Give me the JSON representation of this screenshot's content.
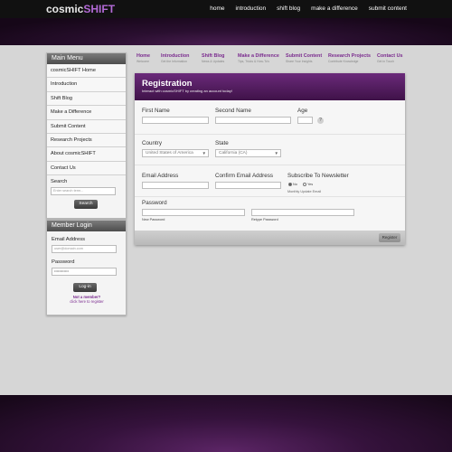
{
  "site": {
    "logo_part1": "cosmic",
    "logo_part2": "SHIFT",
    "accent": "#b36ad6",
    "brand_purple": "#6a2a7a"
  },
  "top_nav": [
    "home",
    "introduction",
    "shift blog",
    "make a difference",
    "submit content"
  ],
  "sub_nav": [
    {
      "title": "Home",
      "sub": "Welcome"
    },
    {
      "title": "Introduction",
      "sub": "Get the Information"
    },
    {
      "title": "Shift Blog",
      "sub": "News & Updates"
    },
    {
      "title": "Make a Difference",
      "sub": "Tips, Tricks & How-To's"
    },
    {
      "title": "Submit Content",
      "sub": "Share Your Insights"
    },
    {
      "title": "Research Projects",
      "sub": "Contribute Knowledge"
    },
    {
      "title": "Contact Us",
      "sub": "Get in Touch"
    }
  ],
  "main_menu": {
    "title": "Main Menu",
    "items": [
      "cosmicSHIFT Home",
      "Introduction",
      "Shift Blog",
      "Make a Difference",
      "Submit Content",
      "Research Projects",
      "About cosmicSHIFT",
      "Contact Us"
    ],
    "search_label": "Search",
    "search_placeholder": "Enter search term...",
    "search_button": "Search"
  },
  "member_login": {
    "title": "Member Login",
    "email_label": "Email Address",
    "email_placeholder": "user@domain.com",
    "password_label": "Password",
    "password_value": "••••••••••••",
    "button": "Log-in",
    "not_member": "Not a member?",
    "register_link": "click here to register"
  },
  "registration": {
    "title": "Registration",
    "subtitle": "Interact with cosmicSHIFT by creating an account today!",
    "first_name_label": "First Name",
    "second_name_label": "Second Name",
    "age_label": "Age",
    "help_icon": "?",
    "country_label": "Country",
    "country_value": "United States of America",
    "state_label": "State",
    "state_value": "California (CA)",
    "email_label": "Email Address",
    "confirm_email_label": "Confirm Email Address",
    "newsletter_label": "Subscribe To Newsletter",
    "newsletter_no": "No",
    "newsletter_yes": "Yes",
    "newsletter_note": "Monthly Update Email",
    "password_label": "Password",
    "new_password_label": "New Password",
    "retype_password_label": "Retype Password",
    "register_button": "Register"
  }
}
